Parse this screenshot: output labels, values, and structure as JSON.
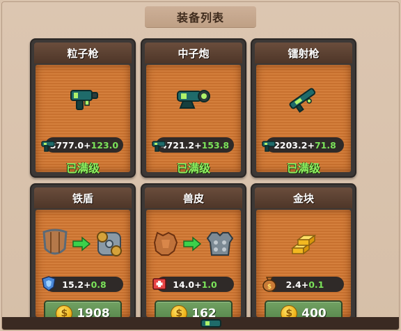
{
  "title": "装备列表",
  "cards": [
    {
      "name": "粒子枪",
      "icon": "particle-gun-icon",
      "base": "3777.0+",
      "bonus": "123.0",
      "status": "已满级",
      "stat_icon": "gun-stat-icon"
    },
    {
      "name": "中子炮",
      "icon": "neutron-cannon-icon",
      "base": "4721.2+",
      "bonus": "153.8",
      "status": "已满级",
      "stat_icon": "gun-stat-icon"
    },
    {
      "name": "镭射枪",
      "icon": "laser-gun-icon",
      "base": "2203.2+",
      "bonus": "71.8",
      "status": "已满级",
      "stat_icon": "gun-stat-icon"
    },
    {
      "name": "铁盾",
      "icon": "iron-shield-icon",
      "base": "15.2+",
      "bonus": "0.8",
      "cost": "1908",
      "stat_icon": "shield-stat-icon"
    },
    {
      "name": "兽皮",
      "icon": "beast-hide-icon",
      "base": "14.0+",
      "bonus": "1.0",
      "cost": "162",
      "stat_icon": "health-stat-icon"
    },
    {
      "name": "金块",
      "icon": "gold-bars-icon",
      "base": "2.4+",
      "bonus": "0.1",
      "cost": "400",
      "stat_icon": "money-bag-stat-icon"
    }
  ],
  "colors": {
    "maxed": "#8ef060",
    "bonus": "#7be35a",
    "button": "#5d8f52"
  }
}
